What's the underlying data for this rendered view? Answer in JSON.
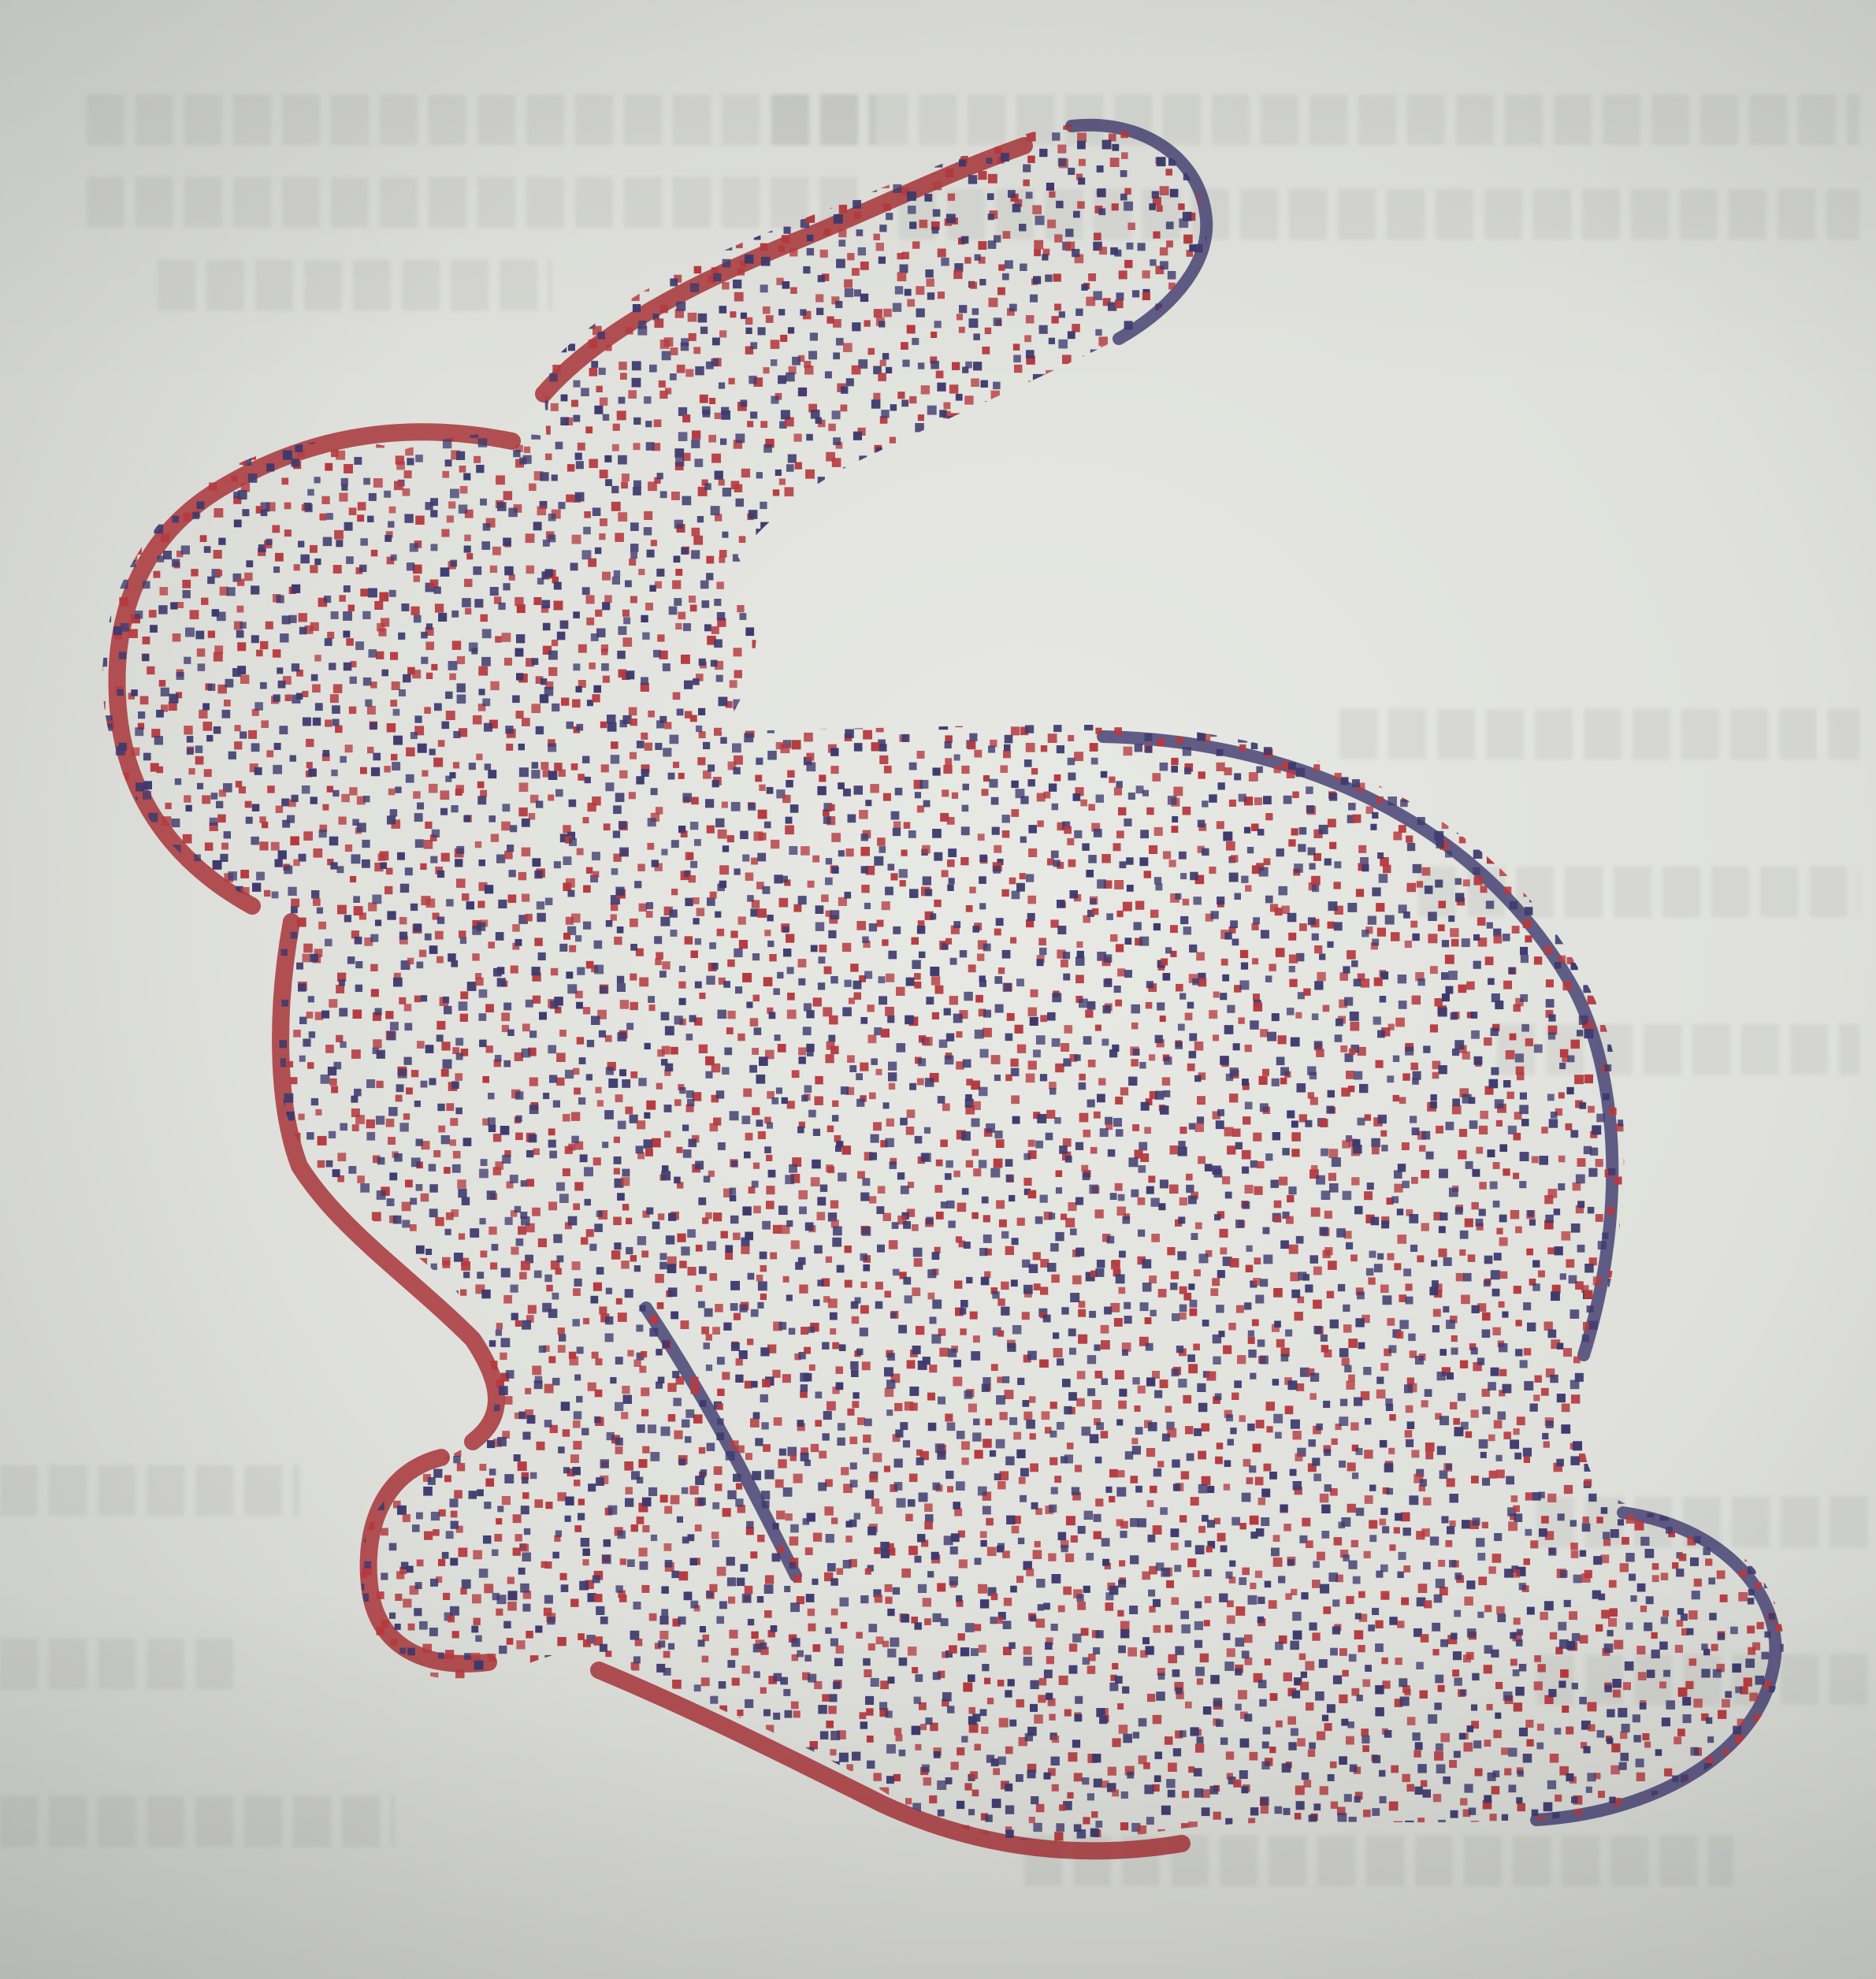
{
  "image": {
    "subject": "point-cloud-bunny",
    "point_cloud": {
      "series": [
        {
          "color": "#b53a3f"
        },
        {
          "color": "#3e3a6e"
        }
      ],
      "outline_color": "#a8353a"
    },
    "paper_color": "#dfe0db"
  }
}
